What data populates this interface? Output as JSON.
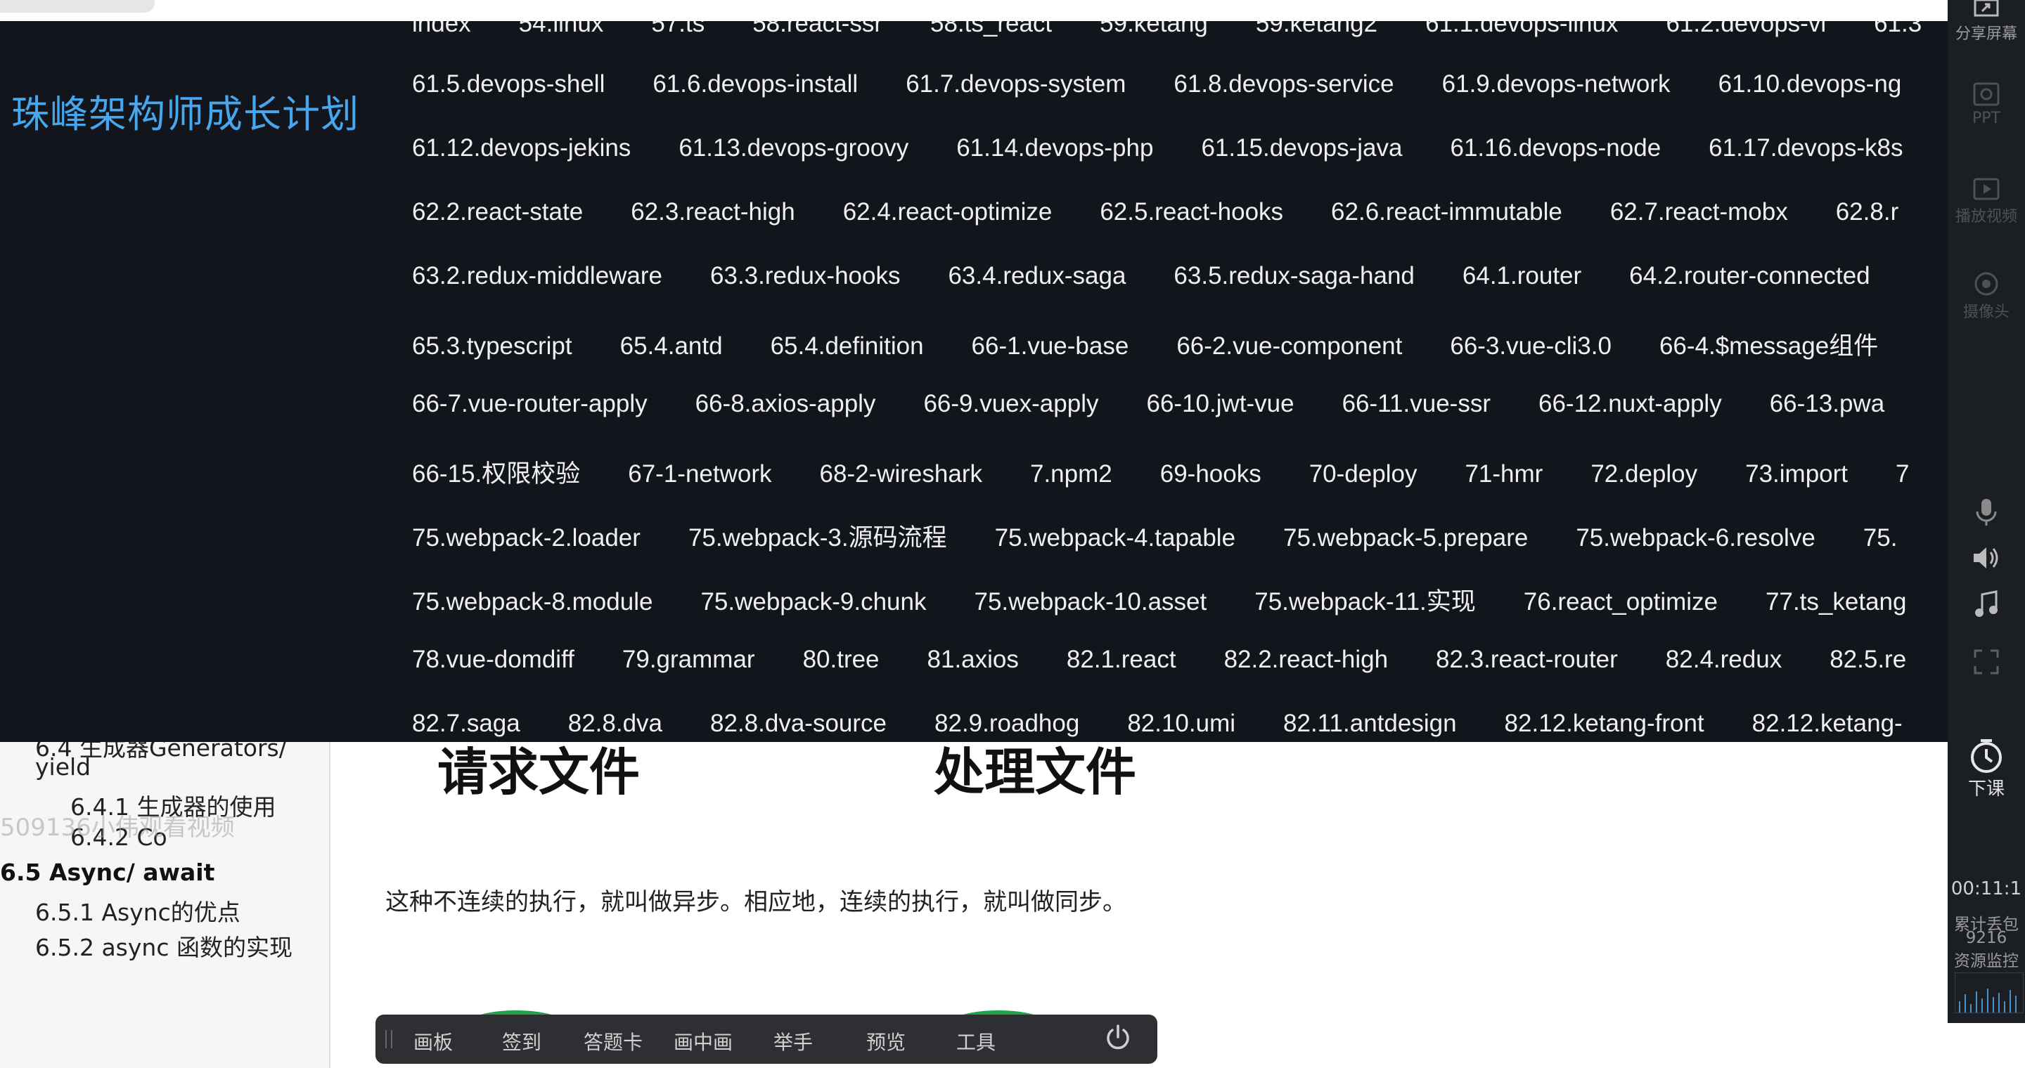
{
  "brand": {
    "title": "珠峰架构师成长计划"
  },
  "nav": {
    "rows": [
      [
        "index",
        "54.linux",
        "57.ts",
        "58.react-ssr",
        "58.ts_react",
        "59.ketang",
        "59.ketang2",
        "61.1.devops-linux",
        "61.2.devops-vi",
        "61.3"
      ],
      [
        "61.5.devops-shell",
        "61.6.devops-install",
        "61.7.devops-system",
        "61.8.devops-service",
        "61.9.devops-network",
        "61.10.devops-ng"
      ],
      [
        "61.12.devops-jekins",
        "61.13.devops-groovy",
        "61.14.devops-php",
        "61.15.devops-java",
        "61.16.devops-node",
        "61.17.devops-k8s"
      ],
      [
        "62.2.react-state",
        "62.3.react-high",
        "62.4.react-optimize",
        "62.5.react-hooks",
        "62.6.react-immutable",
        "62.7.react-mobx",
        "62.8.r"
      ],
      [
        "63.2.redux-middleware",
        "63.3.redux-hooks",
        "63.4.redux-saga",
        "63.5.redux-saga-hand",
        "64.1.router",
        "64.2.router-connected"
      ],
      [
        "65.3.typescript",
        "65.4.antd",
        "65.4.definition",
        "66-1.vue-base",
        "66-2.vue-component",
        "66-3.vue-cli3.0",
        "66-4.$message组件"
      ],
      [
        "66-7.vue-router-apply",
        "66-8.axios-apply",
        "66-9.vuex-apply",
        "66-10.jwt-vue",
        "66-11.vue-ssr",
        "66-12.nuxt-apply",
        "66-13.pwa"
      ],
      [
        "66-15.权限校验",
        "67-1-network",
        "68-2-wireshark",
        "7.npm2",
        "69-hooks",
        "70-deploy",
        "71-hmr",
        "72.deploy",
        "73.import",
        "7"
      ],
      [
        "75.webpack-2.loader",
        "75.webpack-3.源码流程",
        "75.webpack-4.tapable",
        "75.webpack-5.prepare",
        "75.webpack-6.resolve",
        "75."
      ],
      [
        "75.webpack-8.module",
        "75.webpack-9.chunk",
        "75.webpack-10.asset",
        "75.webpack-11.实现",
        "76.react_optimize",
        "77.ts_ketang"
      ],
      [
        "78.vue-domdiff",
        "79.grammar",
        "80.tree",
        "81.axios",
        "82.1.react",
        "82.2.react-high",
        "82.3.react-router",
        "82.4.redux",
        "82.5.re"
      ],
      [
        "82.7.saga",
        "82.8.dva",
        "82.8.dva-source",
        "82.9.roadhog",
        "82.10.umi",
        "82.11.antdesign",
        "82.12.ketang-front",
        "82.12.ketang-"
      ]
    ]
  },
  "toc": {
    "partial_top": "6.4 生成器Generators/",
    "item_yield": "yield",
    "item_641": "6.4.1 生成器的使用",
    "item_642": "6.4.2 Co",
    "item_65": "6.5 Async/ await",
    "item_651": "6.5.1 Async的优点",
    "item_652": "6.5.2 async 函数的实现"
  },
  "watermark": "509136小伟观看视频",
  "content": {
    "heading_left": "请求文件",
    "heading_right": "处理文件",
    "paragraph": "这种不连续的执行，就叫做异步。相应地，连续的执行，就叫做同步。"
  },
  "toolbar": {
    "items": [
      "画板",
      "签到",
      "答题卡",
      "画中画",
      "举手",
      "预览",
      "工具"
    ]
  },
  "sidebar": {
    "share": "分享屏幕",
    "ppt": "PPT",
    "video": "播放视频",
    "camera": "摄像头",
    "class_end": "下课",
    "timer": "00:11:1",
    "stats_label": "累计丢包",
    "stats_value": "9216",
    "monitor": "资源监控"
  },
  "colors": {
    "brand": "#47a7ee",
    "dark_panel": "#12161c",
    "accent_green": "#1fa34a",
    "toolbar_bg": "#2d2f33"
  }
}
